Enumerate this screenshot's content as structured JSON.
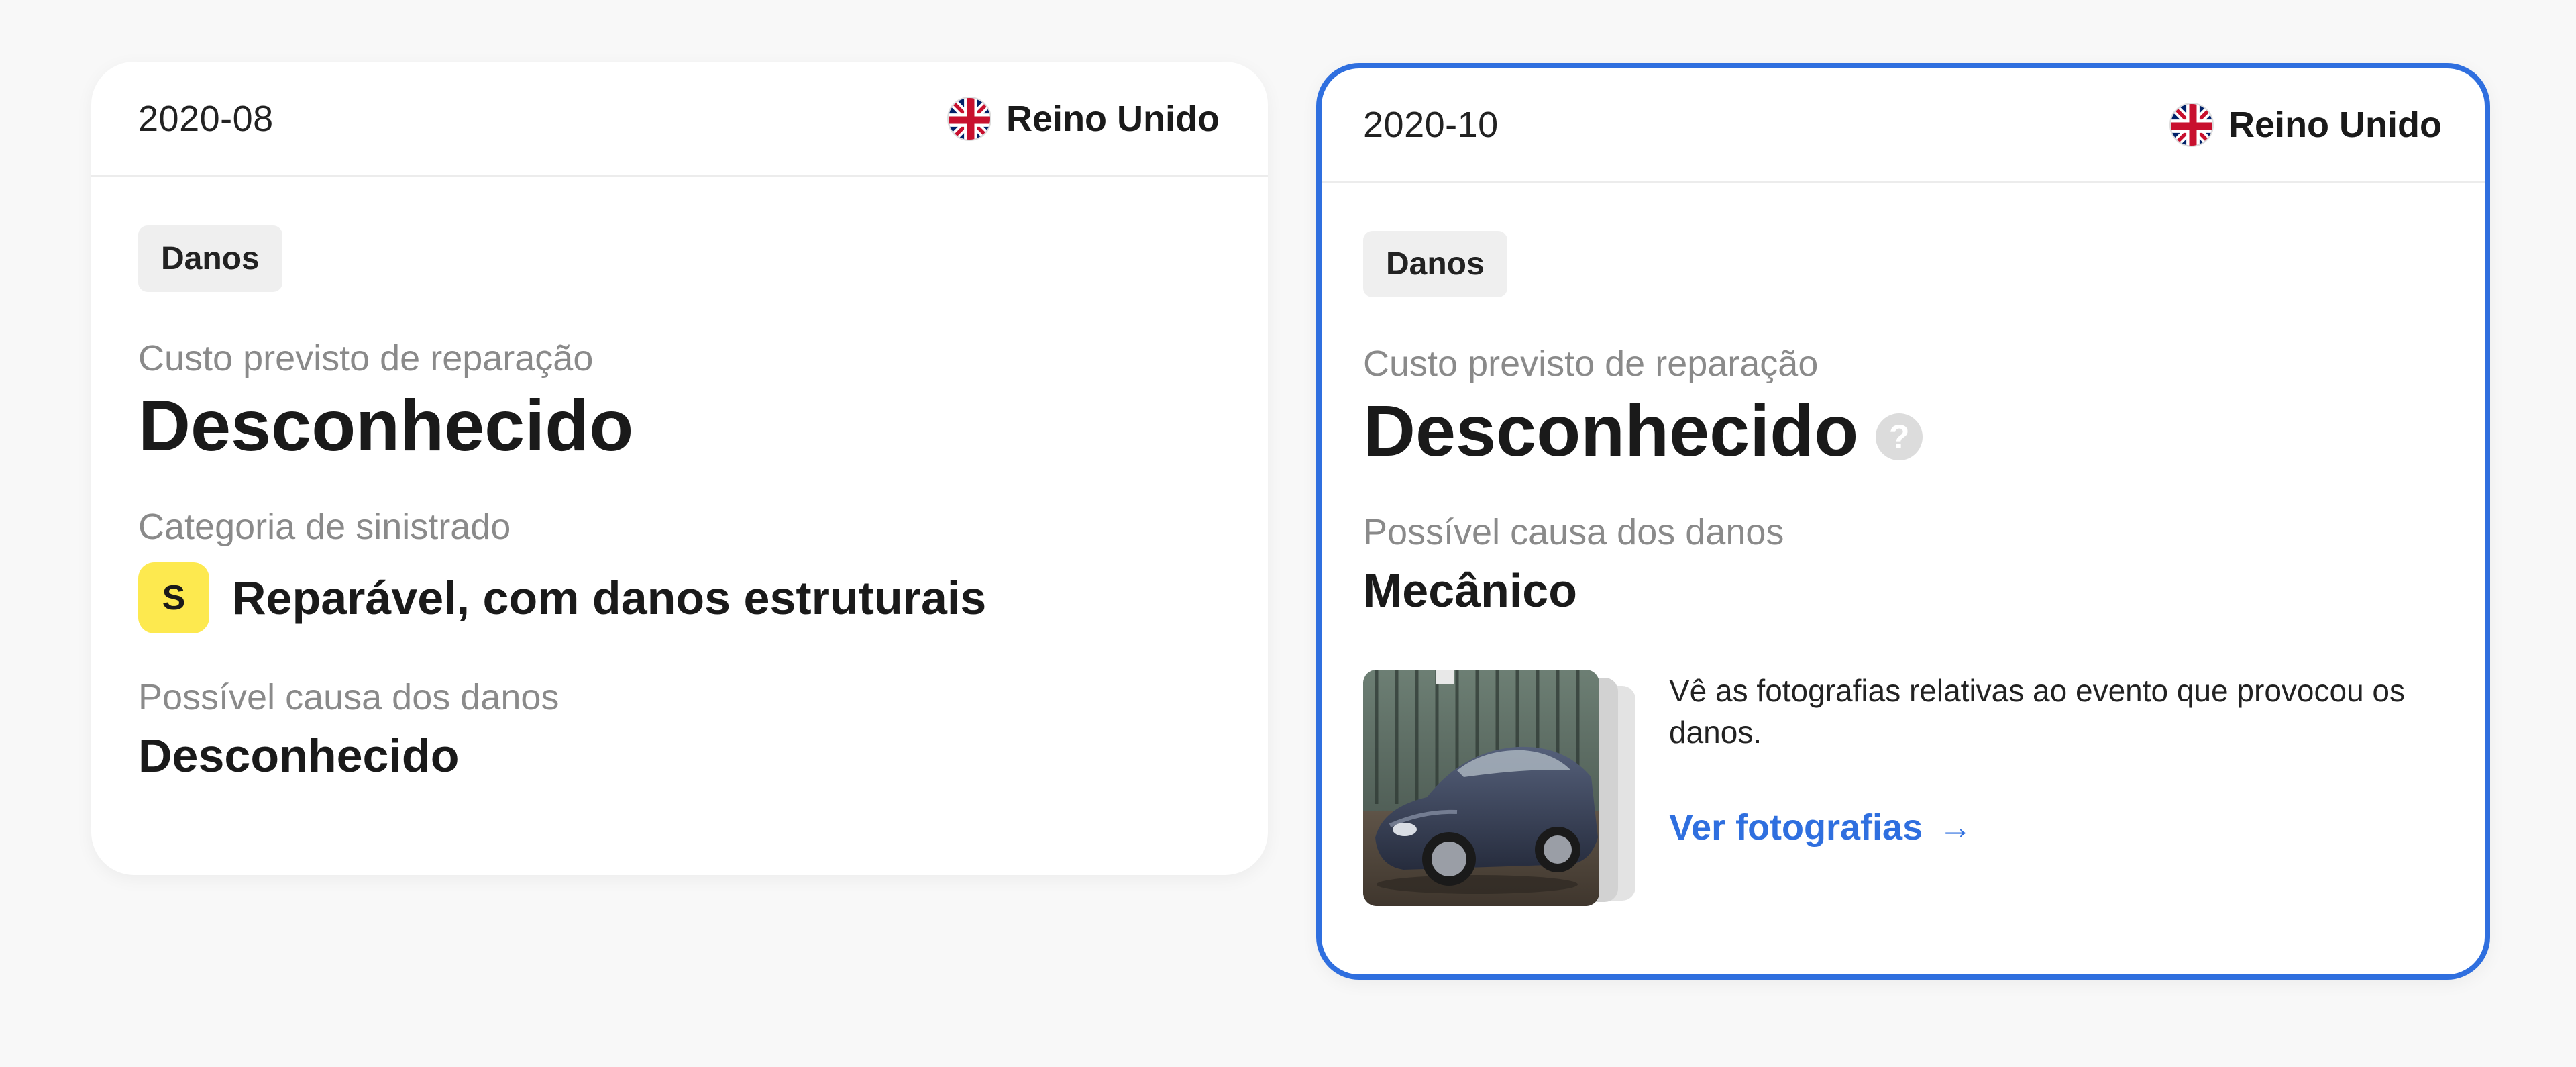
{
  "cards": [
    {
      "date": "2020-08",
      "country": "Reino Unido",
      "badge": "Danos",
      "repair_cost_label": "Custo previsto de reparação",
      "repair_cost_value": "Desconhecido",
      "category_label": "Categoria de sinistrado",
      "category_code": "S",
      "category_text": "Reparável, com danos estruturais",
      "cause_label": "Possível causa dos danos",
      "cause_value": "Desconhecido"
    },
    {
      "date": "2020-10",
      "country": "Reino Unido",
      "badge": "Danos",
      "repair_cost_label": "Custo previsto de reparação",
      "repair_cost_value": "Desconhecido",
      "help_symbol": "?",
      "cause_label": "Possível causa dos danos",
      "cause_value": "Mecânico",
      "photos_description": "Vê as fotografias relativas ao evento que provocou os danos.",
      "photos_link": "Ver fotografias",
      "photos_link_arrow": "→",
      "selected": true
    }
  ],
  "colors": {
    "accent": "#2f6fdf",
    "category_badge": "#fde94f",
    "tag_bg": "#efefef",
    "muted_text": "#8a8a8a"
  },
  "icons": {
    "flag": "uk-flag-icon",
    "help": "question-mark-icon",
    "arrow": "arrow-right-icon"
  }
}
